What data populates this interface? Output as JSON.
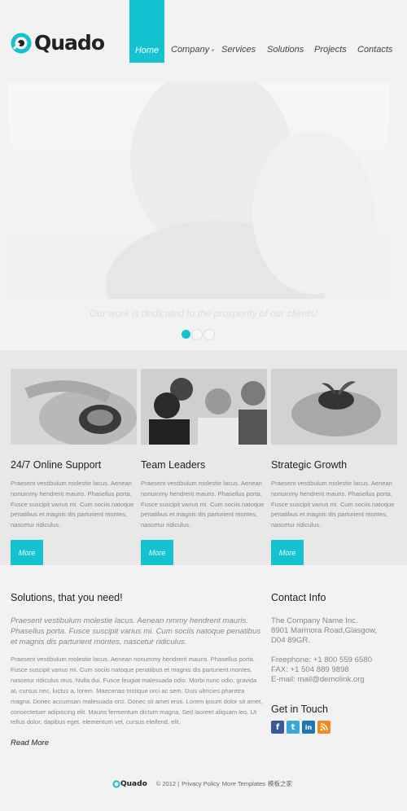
{
  "brand": {
    "name": "Quado",
    "accent": "#15c2d0"
  },
  "nav": {
    "items": [
      {
        "label": "Home"
      },
      {
        "label": "Company"
      },
      {
        "label": "Services"
      },
      {
        "label": "Solutions"
      },
      {
        "label": "Projects"
      },
      {
        "label": "Contacts"
      }
    ],
    "dropdown_icon": "chevron-down-icon"
  },
  "hero": {
    "caption": "Our work is dedicated to the prosperity of our clients!",
    "slides": 3,
    "active_slide": 1
  },
  "features": [
    {
      "title": "24/7 Online Support",
      "text": "Praesent vestibulum molestie lacus. Aenean nonummy hendrerit mauris. Phasellus porta. Fusce suscipit varius mi. Cum sociis natoque penatibus et magnis dis parturient montes, nascetur ridiculus.",
      "button": "More"
    },
    {
      "title": "Team Leaders",
      "text": "Praesent vestibulum molestie lacus. Aenean nonummy hendrerit mauris. Phasellus porta. Fusce suscipit varius mi. Cum sociis natoque penatibus et magnis dis parturient montes, nascetur ridiculus.",
      "button": "More"
    },
    {
      "title": "Strategic Growth",
      "text": "Praesent vestibulum molestie lacus. Aenean nonummy hendrerit mauris. Phasellus porta. Fusce suscipit varius mi. Cum sociis natoque penatibus et magnis dis parturient montes, nascetur ridiculus.",
      "button": "More"
    }
  ],
  "solutions": {
    "title": "Solutions, that you need!",
    "lead": "Praesent vestibulum molestie lacus. Aenean nmmy hendrent mauris. Phasellus porta. Fusce suscipit varius mi. Cum sociis natoque penatibus et magnis dis parturient montes, nascetur ridiculus.",
    "text": "Praesent vestibulum molestie lacus. Aenean nonummy hendrerit mauris. Phasellus porta. Fusce suscipit varius mi. Cum sociis natoque penatibus et magnis dis parturient montes, nascetur ridiculus mus. Nulla dui. Fusce feugiat malesuada odio. Morbi nunc odio, gravida at, cursus nec, luctus a, lorem. Maecenas tristique orci ac sem. Duis ultricies pharetra magna. Donec accumsan malesuada orci. Donec sit amet eros. Lorem ipsum dolor sit amet, consectetuer adipiscing elit. Mauris fermentum dictum magna. Sed laoreet aliquam leo. Ut tellus dolor, dapibus eget, elementum vel, cursus eleifend, elit.",
    "read_more": "Read More"
  },
  "contact": {
    "title": "Contact Info",
    "company": "The Company Name Inc.",
    "address1": "8901 Marmora Road,Glasgow,",
    "address2": "D04 89GR.",
    "phone": "Freephone: +1 800 559 6580",
    "fax": "FAX: +1 504 889 9898",
    "email": "E-mail: mail@demolink.org"
  },
  "get_in_touch": {
    "title": "Get in Touch",
    "icons": [
      "facebook-icon",
      "twitter-icon",
      "linkedin-icon",
      "rss-icon"
    ]
  },
  "footer": {
    "logo": "Quado",
    "copyright": "© 2012 |",
    "privacy": "Privacy Policy",
    "more": "More Templates",
    "cn": "模板之家"
  }
}
